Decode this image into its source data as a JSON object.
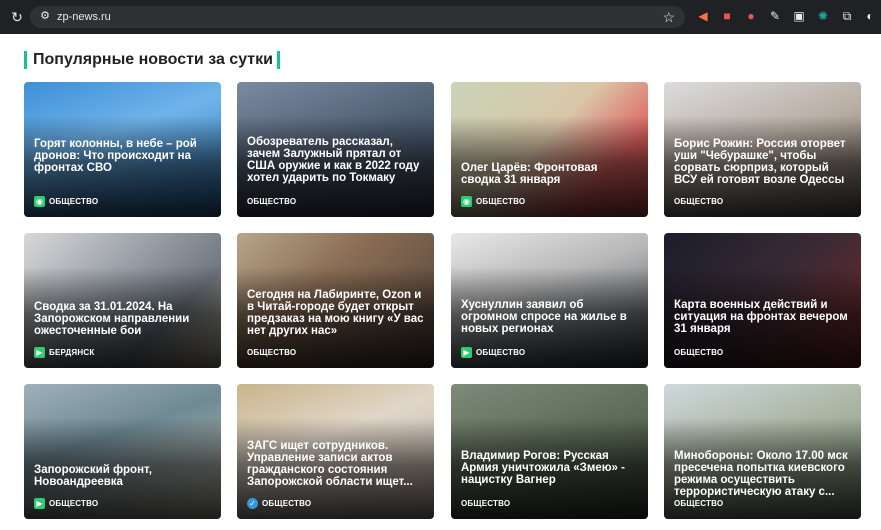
{
  "browser": {
    "reload_icon": "reload-icon",
    "site_icon": "site-settings-icon",
    "url": "zp-news.ru",
    "bookmark_icon": "star-icon",
    "extensions": [
      "cast-icon",
      "pdf-icon",
      "extension-icon",
      "pen-icon",
      "screenshot-icon",
      "atom-icon",
      "puzzle-icon",
      "profile-icon"
    ]
  },
  "section": {
    "title": "Популярные новости за сутки"
  },
  "cards": [
    {
      "title": "Горят колонны, в небе – рой дронов: Что происходит на фронтах СВО",
      "tag": "ОБЩЕСТВО",
      "icon": "camera-icon"
    },
    {
      "title": "Обозреватель рассказал, зачем Залужный прятал от США оружие и как в 2022 году хотел ударить по Токмаку",
      "tag": "ОБЩЕСТВО",
      "icon": ""
    },
    {
      "title": "Олег Царёв: Фронтовая сводка 31 января",
      "tag": "ОБЩЕСТВО",
      "icon": "camera-icon"
    },
    {
      "title": "Борис Рожин: Россия оторвет уши \"Чебурашке\", чтобы сорвать сюрприз, который ВСУ ей готовят возле Одессы",
      "tag": "ОБЩЕСТВО",
      "icon": ""
    },
    {
      "title": "Сводка за 31.01.2024. На Запорожском направлении ожесточенные бои",
      "tag": "БЕРДЯНСК",
      "icon": "video-icon"
    },
    {
      "title": "Сегодня на Лабиринте, Ozon и в Читай-городе будет открыт предзаказ на мою книгу «У вас нет других нас»",
      "tag": "ОБЩЕСТВО",
      "icon": ""
    },
    {
      "title": "Хуснуллин заявил об огромном спросе на жилье в новых регионах",
      "tag": "ОБЩЕСТВО",
      "icon": "video-icon"
    },
    {
      "title": "Карта военных действий и ситуация на фронтах вечером 31 января",
      "tag": "ОБЩЕСТВО",
      "icon": ""
    },
    {
      "title": "Запорожский фронт, Новоандреевка",
      "tag": "ОБЩЕСТВО",
      "icon": "video-icon"
    },
    {
      "title": "ЗАГС ищет сотрудников. Управление записи актов гражданского состояния Запорожской области ищет...",
      "tag": "ОБЩЕСТВО",
      "icon": "check-icon"
    },
    {
      "title": "Владимир Рогов: Русская Армия уничтожила «Змею» - нацистку Вагнер",
      "tag": "ОБЩЕСТВО",
      "icon": ""
    },
    {
      "title": "Минобороны: Около 17.00 мск пресечена попытка киевского режима осуществить террористическую атаку с...",
      "tag": "ОБЩЕСТВО",
      "icon": ""
    }
  ]
}
